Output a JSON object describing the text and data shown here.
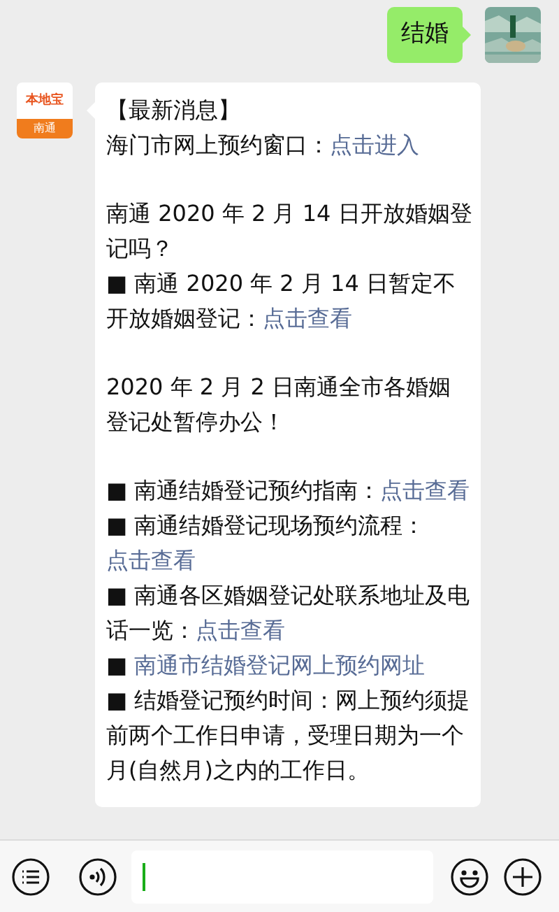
{
  "outgoing": {
    "text": "结婚"
  },
  "incoming": {
    "logo": {
      "brand": "本地宝",
      "city": "南通"
    },
    "groups": [
      [
        [
          {
            "kind": "text",
            "text": "【最新消息】"
          }
        ],
        [
          {
            "kind": "text",
            "text": "海门市网上预约窗口："
          },
          {
            "kind": "link",
            "text": "点击进入"
          }
        ]
      ],
      [
        [
          {
            "kind": "text",
            "text": "南通 2020 年 2 月 14 日开放婚姻登记吗？"
          }
        ],
        [
          {
            "kind": "text",
            "text": "■ 南通 2020 年 2 月 14 日暂定不开放婚姻登记："
          },
          {
            "kind": "link",
            "text": "点击查看"
          }
        ]
      ],
      [
        [
          {
            "kind": "text",
            "text": "2020 年 2 月 2 日南通全市各婚姻登记处暂停办公！"
          }
        ]
      ],
      [
        [
          {
            "kind": "text",
            "text": "■ 南通结婚登记预约指南："
          },
          {
            "kind": "link",
            "text": "点击查看"
          }
        ],
        [
          {
            "kind": "text",
            "text": "■ 南通结婚登记现场预约流程："
          },
          {
            "kind": "link",
            "text": "点击查看"
          }
        ],
        [
          {
            "kind": "text",
            "text": "■ 南通各区婚姻登记处联系地址及电话一览："
          },
          {
            "kind": "link",
            "text": "点击查看"
          }
        ],
        [
          {
            "kind": "text",
            "text": "■ "
          },
          {
            "kind": "link",
            "text": "南通市结婚登记网上预约网址"
          }
        ],
        [
          {
            "kind": "text",
            "text": "■ 结婚登记预约时间：网上预约须提前两个工作日申请，受理日期为一个月(自然月)之内的工作日。"
          }
        ]
      ]
    ]
  }
}
